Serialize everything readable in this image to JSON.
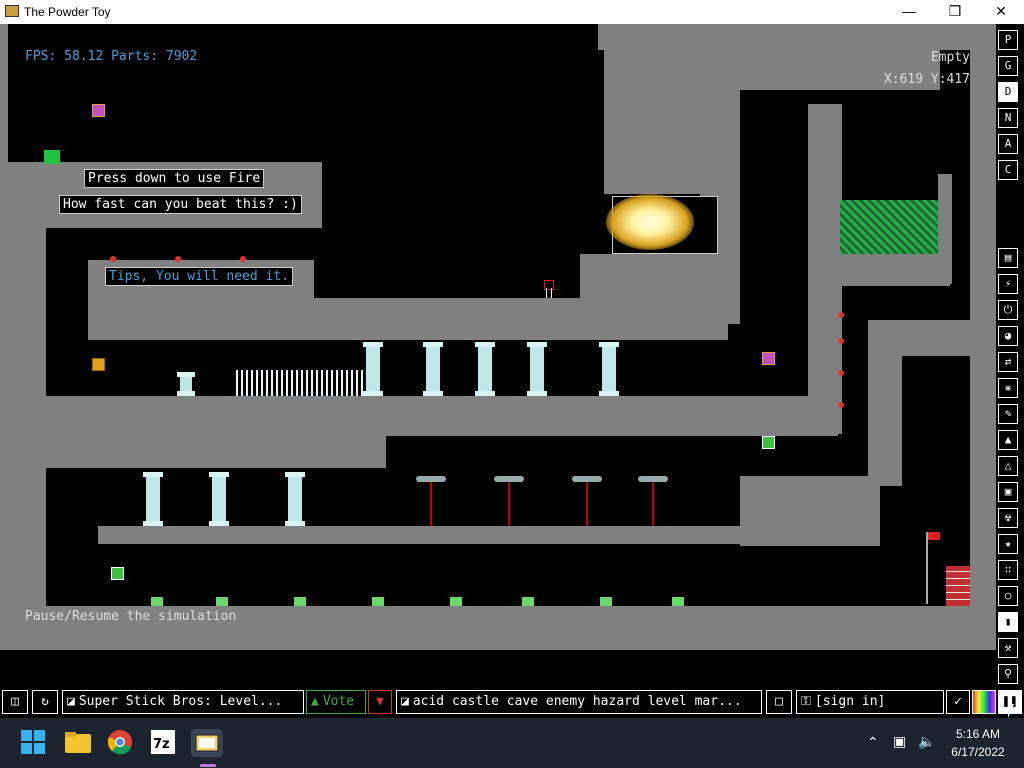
{
  "window": {
    "title": "The Powder Toy"
  },
  "hud": {
    "fps": "FPS: 58.12 Parts: 7902",
    "element": "Empty",
    "coords": "X:619 Y:417",
    "tooltip": "Pause/Resume the simulation"
  },
  "signs": {
    "fire": "Press down to use Fire",
    "speed": "How fast can you beat this? :)",
    "tips": "Tips, You will need it."
  },
  "right_toolbar": {
    "letters": [
      "P",
      "G",
      "D",
      "N",
      "A",
      "C"
    ],
    "icons": [
      "menu-icon",
      "plug-icon",
      "power-icon",
      "gauge-icon",
      "arrows-icon",
      "molecule-icon",
      "pen-icon",
      "flame-icon",
      "flask-icon",
      "square-icon",
      "radiation-icon",
      "star-icon",
      "particles-icon",
      "bulb-icon",
      "bookmark-icon",
      "wrench-icon",
      "search-icon"
    ]
  },
  "bottom_bar": {
    "save_name": "Super Stick Bros: Level...",
    "vote": "Vote",
    "tags": "acid castle cave enemy hazard level mar...",
    "signin": "[sign in]"
  },
  "taskbar": {
    "time": "5:16 AM",
    "date": "6/17/2022",
    "apps": [
      "start-icon",
      "file-explorer-icon",
      "chrome-icon",
      "7zip-icon",
      "powder-toy-icon"
    ]
  },
  "colors": {
    "wall": "#808080",
    "pillar": "#bfe8ea",
    "hud_blue": "#48a0d8"
  }
}
